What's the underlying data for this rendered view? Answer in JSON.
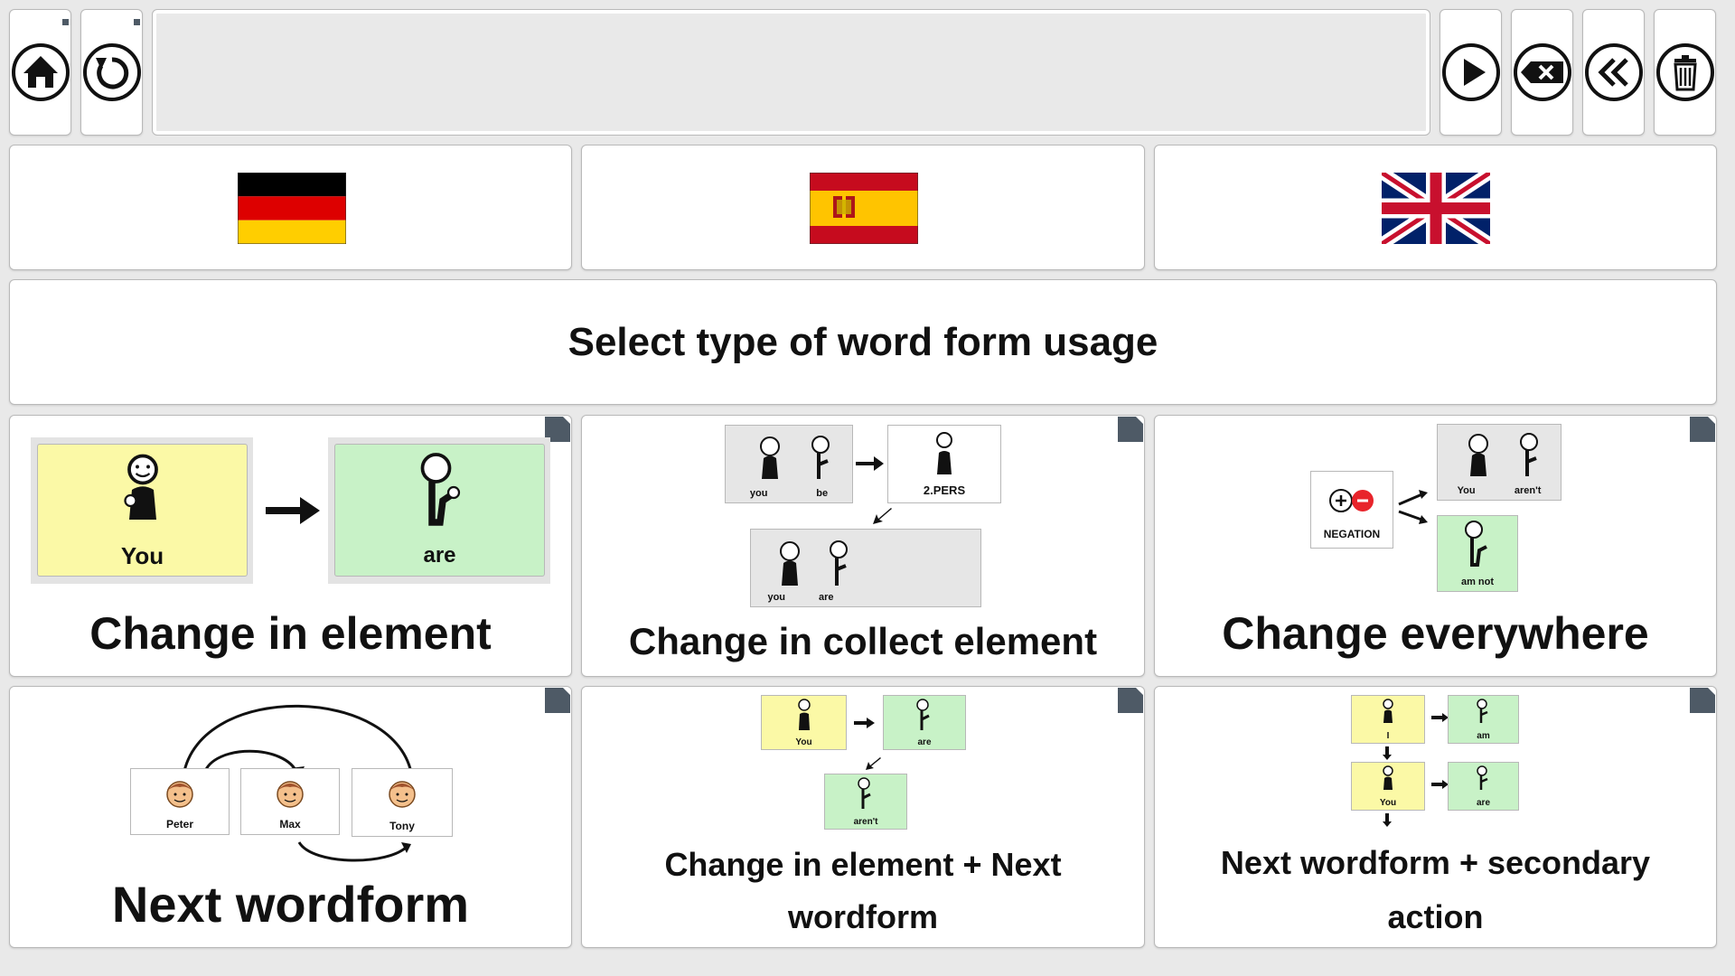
{
  "toolbar": {
    "left_buttons": [
      {
        "name": "home",
        "icon": "home-icon"
      },
      {
        "name": "undo",
        "icon": "undo-icon"
      }
    ],
    "right_buttons": [
      {
        "name": "play",
        "icon": "play-icon"
      },
      {
        "name": "backspace",
        "icon": "backspace-icon"
      },
      {
        "name": "back",
        "icon": "double-chevron-left-icon"
      },
      {
        "name": "delete",
        "icon": "trash-icon"
      }
    ]
  },
  "flags": [
    {
      "name": "german",
      "icon": "flag-germany-icon"
    },
    {
      "name": "spanish",
      "icon": "flag-spain-icon"
    },
    {
      "name": "english",
      "icon": "flag-uk-icon"
    }
  ],
  "header": {
    "title": "Select type of word form usage"
  },
  "cards": {
    "change_in_element": {
      "label": "Change in element",
      "from_word": "You",
      "to_word": "are"
    },
    "change_in_collect": {
      "label": "Change in collect element",
      "top_words": [
        "you",
        "be"
      ],
      "target": "2.PERS",
      "bottom_words": [
        "you",
        "are"
      ]
    },
    "change_everywhere": {
      "label": "Change everywhere",
      "negation": "NEGATION",
      "top_words": [
        "You",
        "aren't"
      ],
      "bottom_word": "am not"
    },
    "next_wordform": {
      "label": "Next wordform",
      "names": [
        "Peter",
        "Max",
        "Tony"
      ]
    },
    "change_plus_next": {
      "label_line1": "Change in element + Next",
      "label_line2": "wordform",
      "words": [
        "You",
        "are",
        "aren't"
      ]
    },
    "next_plus_secondary": {
      "label_line1": "Next wordform + secondary",
      "label_line2": "action",
      "words": [
        "I",
        "am",
        "You",
        "are"
      ]
    }
  },
  "colors": {
    "symbol_yellow": "#fbf9a6",
    "symbol_green": "#c8f2c7",
    "corner_mark": "#4e5a66",
    "background": "#e9e9e9"
  }
}
